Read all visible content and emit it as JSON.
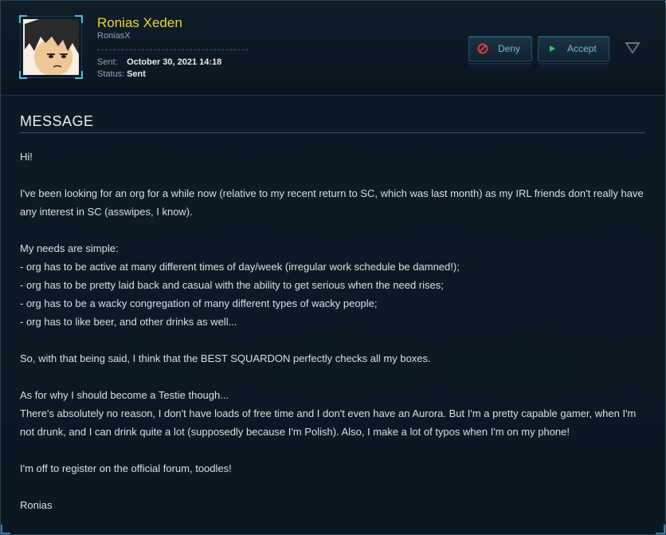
{
  "sender": {
    "name": "Ronias Xeden",
    "handle": "RoniasX",
    "sent_label": "Sent:",
    "sent_value": "October 30, 2021 14:18",
    "status_label": "Status:",
    "status_value": "Sent"
  },
  "actions": {
    "deny_label": "Deny",
    "accept_label": "Accept",
    "deny_icon": "no-entry-icon",
    "accept_icon": "play-icon",
    "menu_icon": "triangle-down-icon"
  },
  "message": {
    "section_title": "MESSAGE",
    "paragraphs": [
      [
        "Hi!"
      ],
      [
        "I've been looking for an org for a while now (relative to my recent return to SC, which was last month) as my IRL friends don't really have any interest in SC (asswipes, I know)."
      ],
      [
        "My needs are simple:",
        "- org has to be active at many different times of day/week (irregular work schedule be damned!);",
        "- org has to be pretty laid back and casual with the ability to get serious when the need rises;",
        "- org has to be a wacky congregation of many different types of wacky people;",
        "- org has to like beer, and other drinks as well..."
      ],
      [
        "So, with that being said, I think that the BEST SQUARDON perfectly checks all my boxes."
      ],
      [
        "As for why I should become a Testie though...",
        "There's absolutely no reason, I don't have loads of free time and I don't even have an Aurora. But I'm a pretty capable gamer, when I'm not drunk, and I can drink quite a lot (supposedly because I'm Polish). Also, I make a lot of typos when I'm on my phone!"
      ],
      [
        "I'm off to register on the official forum, toodles!"
      ],
      [
        "Ronias"
      ]
    ]
  },
  "colors": {
    "name_accent": "#f2d331",
    "frame_accent": "#39c7e8",
    "deny_icon": "#e23b3b",
    "accept_icon": "#35c46a"
  }
}
